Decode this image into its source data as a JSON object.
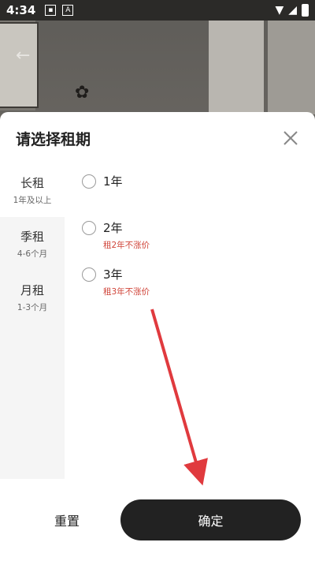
{
  "status_bar": {
    "time": "4:34",
    "icons": [
      "image-notification-icon",
      "a-notification-icon",
      "wifi-icon",
      "signal-icon",
      "battery-icon"
    ]
  },
  "sheet": {
    "title": "请选择租期",
    "close_icon": "close-icon"
  },
  "categories": [
    {
      "label": "长租",
      "sub": "1年及以上",
      "active": true
    },
    {
      "label": "季租",
      "sub": "4-6个月",
      "active": false
    },
    {
      "label": "月租",
      "sub": "1-3个月",
      "active": false
    }
  ],
  "options": [
    {
      "label": "1年",
      "note": "",
      "selected": false
    },
    {
      "label": "2年",
      "note": "租2年不涨价",
      "selected": false
    },
    {
      "label": "3年",
      "note": "租3年不涨价",
      "selected": false
    }
  ],
  "footer": {
    "reset_label": "重置",
    "confirm_label": "确定"
  },
  "colors": {
    "accent_dark": "#222222",
    "note_red": "#d0453a",
    "annotation_red": "#e03a3e"
  }
}
